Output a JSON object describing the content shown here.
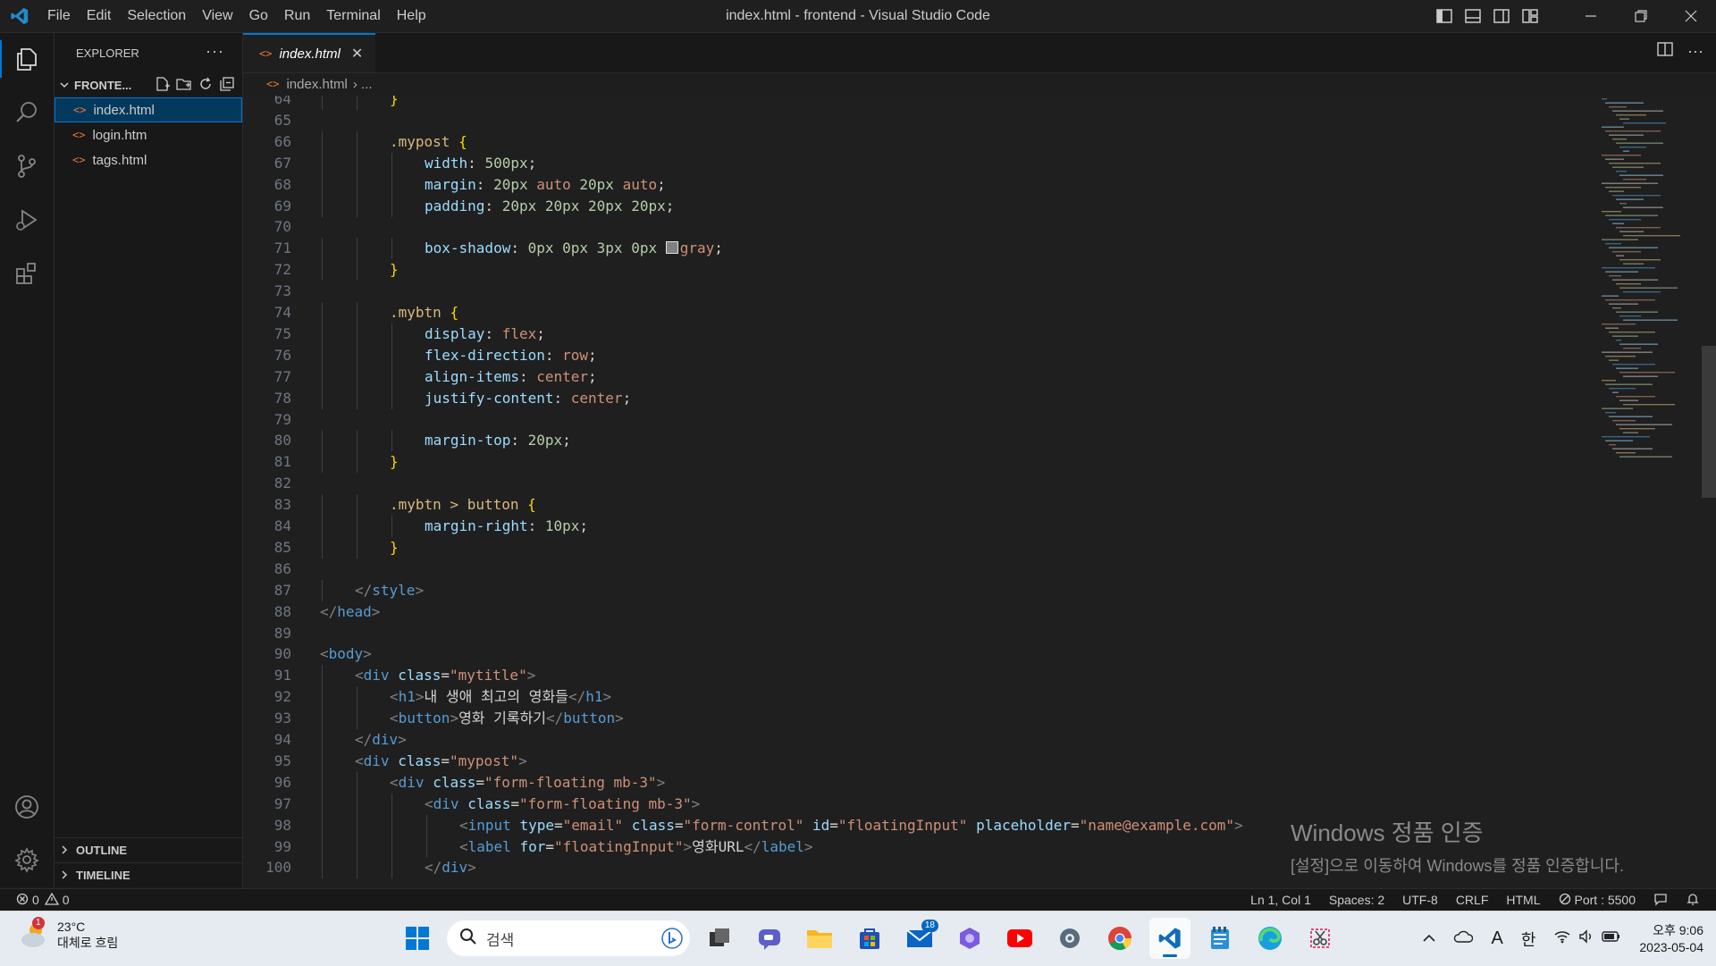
{
  "titlebar": {
    "menu": [
      "File",
      "Edit",
      "Selection",
      "View",
      "Go",
      "Run",
      "Terminal",
      "Help"
    ],
    "title": "index.html - frontend - Visual Studio Code"
  },
  "sidebar": {
    "header": "EXPLORER",
    "more": "···",
    "folder": "FRONTE...",
    "files": [
      "index.html",
      "login.htm",
      "tags.html"
    ],
    "outline": "OUTLINE",
    "timeline": "TIMELINE"
  },
  "tab": {
    "label": "index.html",
    "close": "✕"
  },
  "breadcrumb": {
    "file": "index.html",
    "rest": "› ..."
  },
  "code_lines": [
    {
      "n": "64",
      "indent": 2,
      "tokens": [
        [
          "br",
          "}"
        ]
      ]
    },
    {
      "n": "65",
      "indent": 0,
      "tokens": []
    },
    {
      "n": "66",
      "indent": 2,
      "tokens": [
        [
          "sel",
          ".mypost"
        ],
        [
          "txt",
          " "
        ],
        [
          "br",
          "{"
        ]
      ]
    },
    {
      "n": "67",
      "indent": 3,
      "tokens": [
        [
          "prop",
          "width"
        ],
        [
          "txt",
          ": "
        ],
        [
          "num",
          "500px"
        ],
        [
          "txt",
          ";"
        ]
      ]
    },
    {
      "n": "68",
      "indent": 3,
      "tokens": [
        [
          "prop",
          "margin"
        ],
        [
          "txt",
          ": "
        ],
        [
          "num",
          "20px"
        ],
        [
          "txt",
          " "
        ],
        [
          "val",
          "auto"
        ],
        [
          "txt",
          " "
        ],
        [
          "num",
          "20px"
        ],
        [
          "txt",
          " "
        ],
        [
          "val",
          "auto"
        ],
        [
          "txt",
          ";"
        ]
      ]
    },
    {
      "n": "69",
      "indent": 3,
      "tokens": [
        [
          "prop",
          "padding"
        ],
        [
          "txt",
          ": "
        ],
        [
          "num",
          "20px 20px 20px 20px"
        ],
        [
          "txt",
          ";"
        ]
      ]
    },
    {
      "n": "70",
      "indent": 0,
      "tokens": []
    },
    {
      "n": "71",
      "indent": 3,
      "tokens": [
        [
          "prop",
          "box-shadow"
        ],
        [
          "txt",
          ": "
        ],
        [
          "num",
          "0px 0px 3px 0px"
        ],
        [
          "txt",
          " "
        ],
        [
          "swatch",
          ""
        ],
        [
          "val",
          "gray"
        ],
        [
          "txt",
          ";"
        ]
      ]
    },
    {
      "n": "72",
      "indent": 2,
      "tokens": [
        [
          "br",
          "}"
        ]
      ]
    },
    {
      "n": "73",
      "indent": 0,
      "tokens": []
    },
    {
      "n": "74",
      "indent": 2,
      "tokens": [
        [
          "sel",
          ".mybtn"
        ],
        [
          "txt",
          " "
        ],
        [
          "br",
          "{"
        ]
      ]
    },
    {
      "n": "75",
      "indent": 3,
      "tokens": [
        [
          "prop",
          "display"
        ],
        [
          "txt",
          ": "
        ],
        [
          "val",
          "flex"
        ],
        [
          "txt",
          ";"
        ]
      ]
    },
    {
      "n": "76",
      "indent": 3,
      "tokens": [
        [
          "prop",
          "flex-direction"
        ],
        [
          "txt",
          ": "
        ],
        [
          "val",
          "row"
        ],
        [
          "txt",
          ";"
        ]
      ]
    },
    {
      "n": "77",
      "indent": 3,
      "tokens": [
        [
          "prop",
          "align-items"
        ],
        [
          "txt",
          ": "
        ],
        [
          "val",
          "center"
        ],
        [
          "txt",
          ";"
        ]
      ]
    },
    {
      "n": "78",
      "indent": 3,
      "tokens": [
        [
          "prop",
          "justify-content"
        ],
        [
          "txt",
          ": "
        ],
        [
          "val",
          "center"
        ],
        [
          "txt",
          ";"
        ]
      ]
    },
    {
      "n": "79",
      "indent": 0,
      "tokens": []
    },
    {
      "n": "80",
      "indent": 3,
      "tokens": [
        [
          "prop",
          "margin-top"
        ],
        [
          "txt",
          ": "
        ],
        [
          "num",
          "20px"
        ],
        [
          "txt",
          ";"
        ]
      ]
    },
    {
      "n": "81",
      "indent": 2,
      "tokens": [
        [
          "br",
          "}"
        ]
      ]
    },
    {
      "n": "82",
      "indent": 0,
      "tokens": []
    },
    {
      "n": "83",
      "indent": 2,
      "tokens": [
        [
          "sel",
          ".mybtn > button"
        ],
        [
          "txt",
          " "
        ],
        [
          "br",
          "{"
        ]
      ]
    },
    {
      "n": "84",
      "indent": 3,
      "tokens": [
        [
          "prop",
          "margin-right"
        ],
        [
          "txt",
          ": "
        ],
        [
          "num",
          "10px"
        ],
        [
          "txt",
          ";"
        ]
      ]
    },
    {
      "n": "85",
      "indent": 2,
      "tokens": [
        [
          "br",
          "}"
        ]
      ]
    },
    {
      "n": "86",
      "indent": 0,
      "tokens": []
    },
    {
      "n": "87",
      "indent": 1,
      "tokens": [
        [
          "tag",
          "</"
        ],
        [
          "tn",
          "style"
        ],
        [
          "tag",
          ">"
        ]
      ]
    },
    {
      "n": "88",
      "indent": 0,
      "tokens": [
        [
          "tag",
          "</"
        ],
        [
          "tn",
          "head"
        ],
        [
          "tag",
          ">"
        ]
      ]
    },
    {
      "n": "89",
      "indent": 0,
      "tokens": []
    },
    {
      "n": "90",
      "indent": 0,
      "tokens": [
        [
          "tag",
          "<"
        ],
        [
          "tn",
          "body"
        ],
        [
          "tag",
          ">"
        ]
      ]
    },
    {
      "n": "91",
      "indent": 1,
      "tokens": [
        [
          "tag",
          "<"
        ],
        [
          "tn",
          "div"
        ],
        [
          "txt",
          " "
        ],
        [
          "an",
          "class"
        ],
        [
          "txt",
          "="
        ],
        [
          "av",
          "\"mytitle\""
        ],
        [
          "tag",
          ">"
        ]
      ]
    },
    {
      "n": "92",
      "indent": 2,
      "tokens": [
        [
          "tag",
          "<"
        ],
        [
          "tn",
          "h1"
        ],
        [
          "tag",
          ">"
        ],
        [
          "txt",
          "내 생애 최고의 영화들"
        ],
        [
          "tag",
          "</"
        ],
        [
          "tn",
          "h1"
        ],
        [
          "tag",
          ">"
        ]
      ]
    },
    {
      "n": "93",
      "indent": 2,
      "tokens": [
        [
          "tag",
          "<"
        ],
        [
          "tn",
          "button"
        ],
        [
          "tag",
          ">"
        ],
        [
          "txt",
          "영화 기록하기"
        ],
        [
          "tag",
          "</"
        ],
        [
          "tn",
          "button"
        ],
        [
          "tag",
          ">"
        ]
      ]
    },
    {
      "n": "94",
      "indent": 1,
      "tokens": [
        [
          "tag",
          "</"
        ],
        [
          "tn",
          "div"
        ],
        [
          "tag",
          ">"
        ]
      ]
    },
    {
      "n": "95",
      "indent": 1,
      "tokens": [
        [
          "tag",
          "<"
        ],
        [
          "tn",
          "div"
        ],
        [
          "txt",
          " "
        ],
        [
          "an",
          "class"
        ],
        [
          "txt",
          "="
        ],
        [
          "av",
          "\"mypost\""
        ],
        [
          "tag",
          ">"
        ]
      ]
    },
    {
      "n": "96",
      "indent": 2,
      "tokens": [
        [
          "tag",
          "<"
        ],
        [
          "tn",
          "div"
        ],
        [
          "txt",
          " "
        ],
        [
          "an",
          "class"
        ],
        [
          "txt",
          "="
        ],
        [
          "av",
          "\"form-floating mb-3\""
        ],
        [
          "tag",
          ">"
        ]
      ]
    },
    {
      "n": "97",
      "indent": 3,
      "tokens": [
        [
          "tag",
          "<"
        ],
        [
          "tn",
          "div"
        ],
        [
          "txt",
          " "
        ],
        [
          "an",
          "class"
        ],
        [
          "txt",
          "="
        ],
        [
          "av",
          "\"form-floating mb-3\""
        ],
        [
          "tag",
          ">"
        ]
      ]
    },
    {
      "n": "98",
      "indent": 4,
      "tokens": [
        [
          "tag",
          "<"
        ],
        [
          "tn",
          "input"
        ],
        [
          "txt",
          " "
        ],
        [
          "an",
          "type"
        ],
        [
          "txt",
          "="
        ],
        [
          "av",
          "\"email\""
        ],
        [
          "txt",
          " "
        ],
        [
          "an",
          "class"
        ],
        [
          "txt",
          "="
        ],
        [
          "av",
          "\"form-control\""
        ],
        [
          "txt",
          " "
        ],
        [
          "an",
          "id"
        ],
        [
          "txt",
          "="
        ],
        [
          "av",
          "\"floatingInput\""
        ],
        [
          "txt",
          " "
        ],
        [
          "an",
          "placeholder"
        ],
        [
          "txt",
          "="
        ],
        [
          "av",
          "\"name@example.com\""
        ],
        [
          "tag",
          ">"
        ]
      ]
    },
    {
      "n": "99",
      "indent": 4,
      "tokens": [
        [
          "tag",
          "<"
        ],
        [
          "tn",
          "label"
        ],
        [
          "txt",
          " "
        ],
        [
          "an",
          "for"
        ],
        [
          "txt",
          "="
        ],
        [
          "av",
          "\"floatingInput\""
        ],
        [
          "tag",
          ">"
        ],
        [
          "txt",
          "영화URL"
        ],
        [
          "tag",
          "</"
        ],
        [
          "tn",
          "label"
        ],
        [
          "tag",
          ">"
        ]
      ]
    },
    {
      "n": "100",
      "indent": 3,
      "tokens": [
        [
          "tag",
          "</"
        ],
        [
          "tn",
          "div"
        ],
        [
          "tag",
          ">"
        ]
      ]
    }
  ],
  "watermark": {
    "line1": "Windows 정품 인증",
    "line2": "[설정]으로 이동하여 Windows를 정품 인증합니다."
  },
  "statusbar": {
    "errors": "0",
    "warnings": "0",
    "position": "Ln 1, Col 1",
    "spaces": "Spaces: 2",
    "encoding": "UTF-8",
    "eol": "CRLF",
    "language": "HTML",
    "port": "Port : 5500"
  },
  "taskbar": {
    "weather_badge": "1",
    "temp": "23°C",
    "condition": "대체로 흐림",
    "search_placeholder": "검색",
    "mail_badge": "18",
    "ime_mode": "A",
    "ime_lang": "한",
    "time": "오후 9:06",
    "date": "2023-05-04"
  },
  "colors": {
    "accent": "#0078d4",
    "editor_bg": "#1f1f1f",
    "html_file_icon": "#e37933"
  }
}
